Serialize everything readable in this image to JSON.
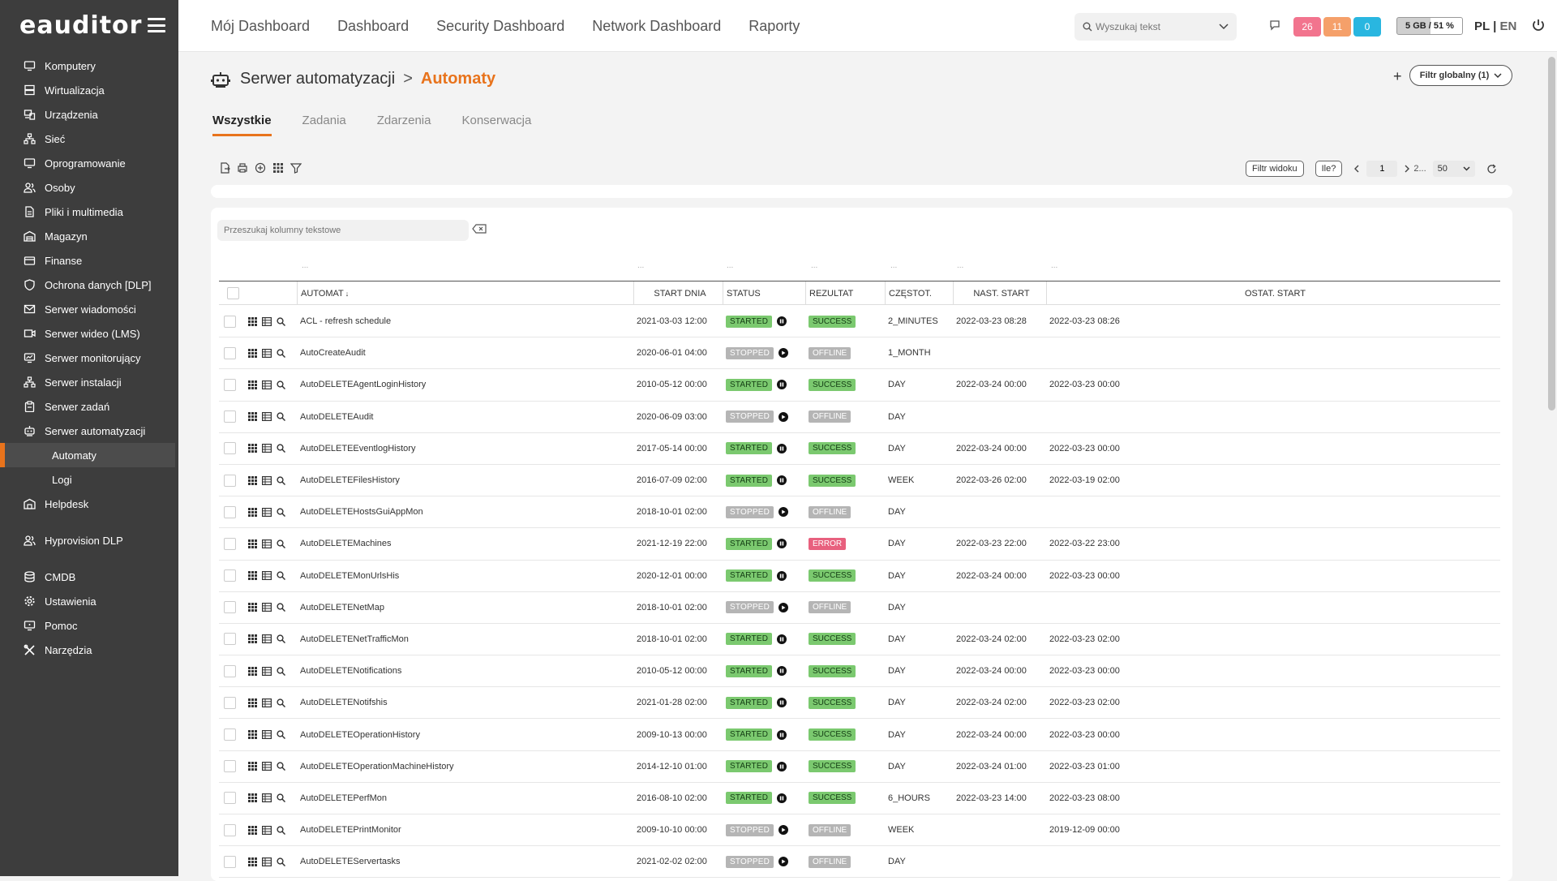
{
  "app": {
    "logo": "eauditor"
  },
  "sidebar": {
    "items": [
      {
        "label": "Komputery",
        "icon": "monitor-icon"
      },
      {
        "label": "Wirtualizacja",
        "icon": "server-stack-icon"
      },
      {
        "label": "Urządzenia",
        "icon": "devices-icon"
      },
      {
        "label": "Sieć",
        "icon": "network-icon"
      },
      {
        "label": "Oprogramowanie",
        "icon": "monitor-icon"
      },
      {
        "label": "Osoby",
        "icon": "people-icon"
      },
      {
        "label": "Pliki i multimedia",
        "icon": "file-icon"
      },
      {
        "label": "Magazyn",
        "icon": "warehouse-icon"
      },
      {
        "label": "Finanse",
        "icon": "finance-icon"
      },
      {
        "label": "Ochrona danych [DLP]",
        "icon": "shield-icon"
      },
      {
        "label": "Serwer wiadomości",
        "icon": "mail-icon"
      },
      {
        "label": "Serwer wideo (LMS)",
        "icon": "video-icon"
      },
      {
        "label": "Serwer monitorujący",
        "icon": "chart-monitor-icon"
      },
      {
        "label": "Serwer instalacji",
        "icon": "network-icon"
      },
      {
        "label": "Serwer zadań",
        "icon": "clipboard-icon"
      },
      {
        "label": "Serwer automatyzacji",
        "icon": "robot-icon"
      }
    ],
    "sub": [
      {
        "label": "Automaty"
      },
      {
        "label": "Logi"
      }
    ],
    "items2": [
      {
        "label": "Helpdesk",
        "icon": "helpdesk-icon"
      }
    ],
    "items3": [
      {
        "label": "Hyprovision DLP",
        "icon": "people-icon"
      }
    ],
    "items4": [
      {
        "label": "CMDB",
        "icon": "database-icon"
      },
      {
        "label": "Ustawienia",
        "icon": "gear-icon"
      },
      {
        "label": "Pomoc",
        "icon": "help-monitor-icon"
      },
      {
        "label": "Narzędzia",
        "icon": "tools-icon"
      }
    ]
  },
  "topnav": [
    "Mój Dashboard",
    "Dashboard",
    "Security Dashboard",
    "Network Dashboard",
    "Raporty"
  ],
  "header": {
    "search_placeholder": "Wyszukaj tekst",
    "badges": [
      {
        "value": "26",
        "color": "#f2748e"
      },
      {
        "value": "11",
        "color": "#f5a06a"
      },
      {
        "value": "0",
        "color": "#29b6e0"
      }
    ],
    "storage": "5 GB / 51 %",
    "lang_pl": "PL",
    "lang_sep": "|",
    "lang_en": "EN"
  },
  "page": {
    "crumb1": "Serwer automatyzacji",
    "crumb_sep": ">",
    "crumb2": "Automaty",
    "add": "+",
    "global_filter": "Filtr globalny (1)",
    "tabs": [
      "Wszystkie",
      "Zadania",
      "Zdarzenia",
      "Konserwacja"
    ],
    "view_filter": "Filtr widoku",
    "how_many": "Ile?",
    "page_value": "1",
    "page_total": "2...",
    "per_page": "50",
    "col_search_placeholder": "Przeszukaj kolumny tekstowe",
    "dots": "..."
  },
  "table": {
    "headers": {
      "automat": "AUTOMAT",
      "sort_mark": "↓",
      "start": "START DNIA",
      "status": "STATUS",
      "result": "REZULTAT",
      "freq": "CZĘSTOT.",
      "next": "NAST. START",
      "last": "OSTAT. START"
    },
    "rows": [
      [
        "ACL - refresh schedule",
        "2021-03-03 12:00",
        "STARTED",
        "SUCCESS",
        "2_MINUTES",
        "2022-03-23 08:28",
        "2022-03-23 08:26"
      ],
      [
        "AutoCreateAudit",
        "2020-06-01 04:00",
        "STOPPED",
        "OFFLINE",
        "1_MONTH",
        "",
        ""
      ],
      [
        "AutoDELETEAgentLoginHistory",
        "2010-05-12 00:00",
        "STARTED",
        "SUCCESS",
        "DAY",
        "2022-03-24 00:00",
        "2022-03-23 00:00"
      ],
      [
        "AutoDELETEAudit",
        "2020-06-09 03:00",
        "STOPPED",
        "OFFLINE",
        "DAY",
        "",
        ""
      ],
      [
        "AutoDELETEEventlogHistory",
        "2017-05-14 00:00",
        "STARTED",
        "SUCCESS",
        "DAY",
        "2022-03-24 00:00",
        "2022-03-23 00:00"
      ],
      [
        "AutoDELETEFilesHistory",
        "2016-07-09 02:00",
        "STARTED",
        "SUCCESS",
        "WEEK",
        "2022-03-26 02:00",
        "2022-03-19 02:00"
      ],
      [
        "AutoDELETEHostsGuiAppMon",
        "2018-10-01 02:00",
        "STOPPED",
        "OFFLINE",
        "DAY",
        "",
        ""
      ],
      [
        "AutoDELETEMachines",
        "2021-12-19 22:00",
        "STARTED",
        "ERROR",
        "DAY",
        "2022-03-23 22:00",
        "2022-03-22 23:00"
      ],
      [
        "AutoDELETEMonUrlsHis",
        "2020-12-01 00:00",
        "STARTED",
        "SUCCESS",
        "DAY",
        "2022-03-24 00:00",
        "2022-03-23 00:00"
      ],
      [
        "AutoDELETENetMap",
        "2018-10-01 02:00",
        "STOPPED",
        "OFFLINE",
        "DAY",
        "",
        ""
      ],
      [
        "AutoDELETENetTrafficMon",
        "2018-10-01 02:00",
        "STARTED",
        "SUCCESS",
        "DAY",
        "2022-03-24 02:00",
        "2022-03-23 02:00"
      ],
      [
        "AutoDELETENotifications",
        "2010-05-12 00:00",
        "STARTED",
        "SUCCESS",
        "DAY",
        "2022-03-24 00:00",
        "2022-03-23 00:00"
      ],
      [
        "AutoDELETENotifshis",
        "2021-01-28 02:00",
        "STARTED",
        "SUCCESS",
        "DAY",
        "2022-03-24 02:00",
        "2022-03-23 02:00"
      ],
      [
        "AutoDELETEOperationHistory",
        "2009-10-13 00:00",
        "STARTED",
        "SUCCESS",
        "DAY",
        "2022-03-24 00:00",
        "2022-03-23 00:00"
      ],
      [
        "AutoDELETEOperationMachineHistory",
        "2014-12-10 01:00",
        "STARTED",
        "SUCCESS",
        "DAY",
        "2022-03-24 01:00",
        "2022-03-23 01:00"
      ],
      [
        "AutoDELETEPerfMon",
        "2016-08-10 02:00",
        "STARTED",
        "SUCCESS",
        "6_HOURS",
        "2022-03-23 14:00",
        "2022-03-23 08:00"
      ],
      [
        "AutoDELETEPrintMonitor",
        "2009-10-10 00:00",
        "STOPPED",
        "OFFLINE",
        "WEEK",
        "",
        "2019-12-09 00:00"
      ],
      [
        "AutoDELETEServertasks",
        "2021-02-02 02:00",
        "STOPPED",
        "OFFLINE",
        "DAY",
        "",
        ""
      ]
    ]
  }
}
